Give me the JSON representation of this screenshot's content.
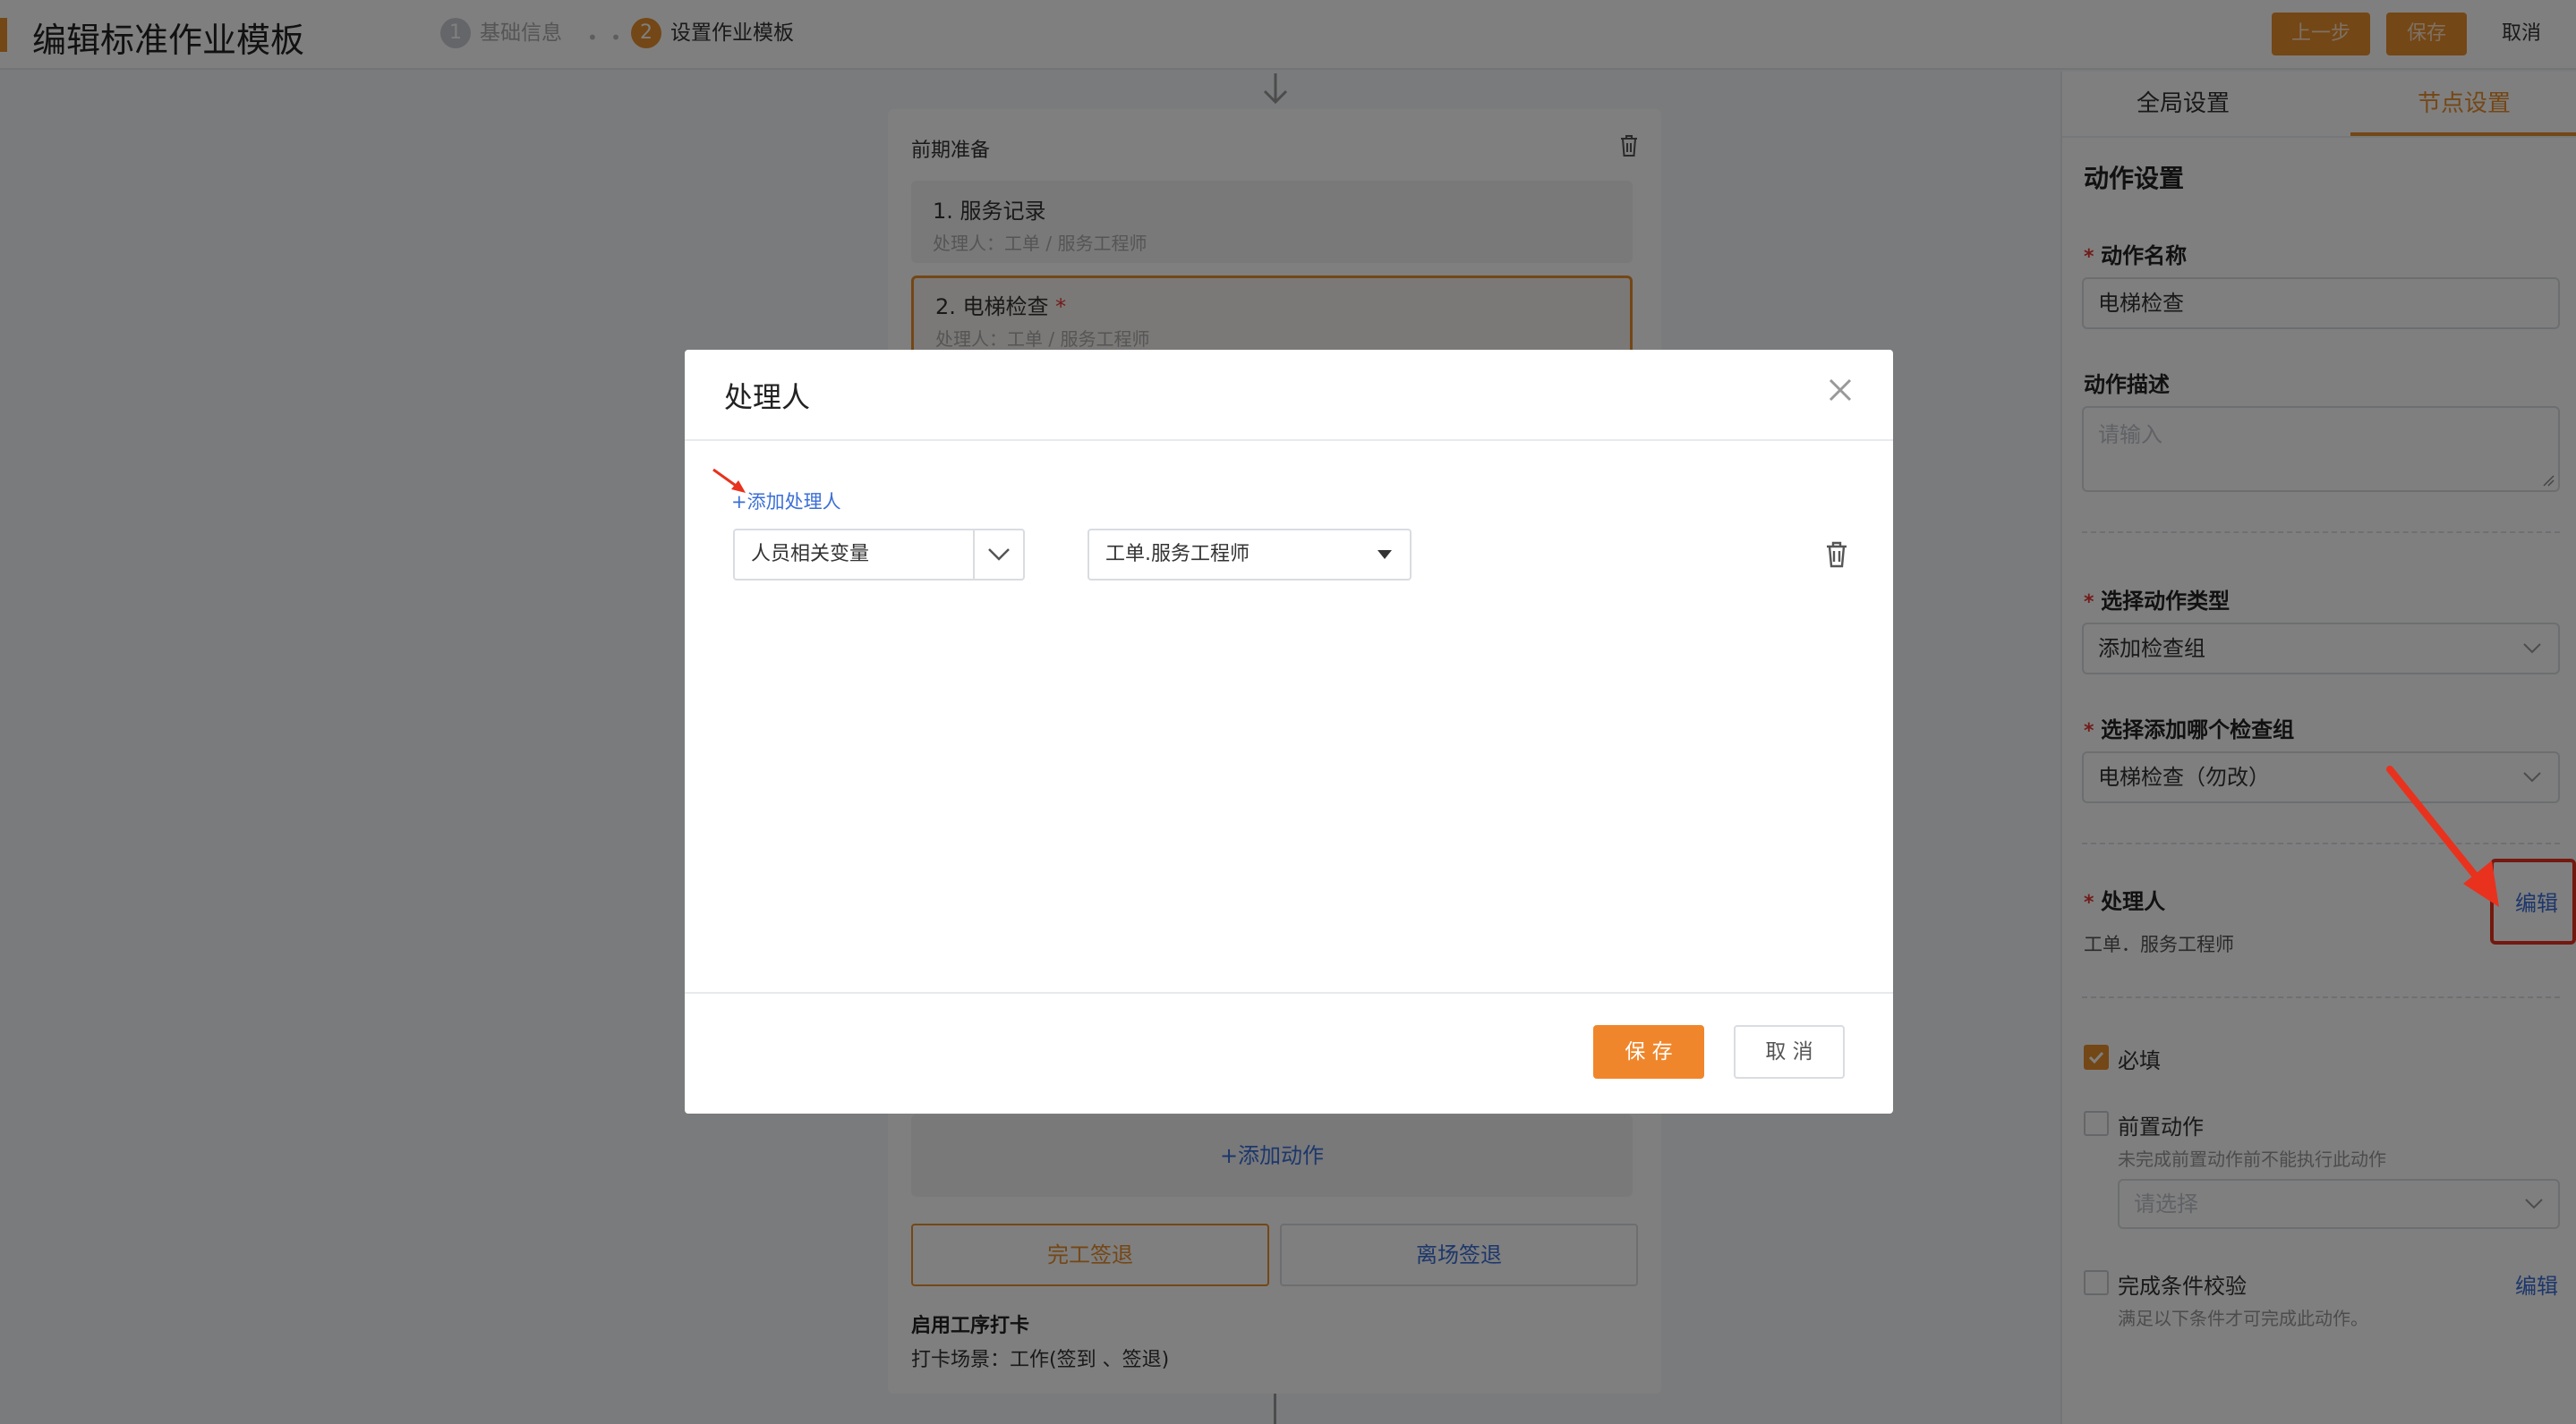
{
  "header": {
    "title": "编辑标准作业模板",
    "steps": [
      {
        "num": "1",
        "label": "基础信息",
        "active": false
      },
      {
        "num": "2",
        "label": "设置作业模板",
        "active": true
      }
    ],
    "buttons": {
      "prev": "上一步",
      "save": "保存",
      "cancel": "取消"
    }
  },
  "canvas": {
    "group_title": "前期准备",
    "actions": [
      {
        "title": "1. 服务记录",
        "handler": "处理人：工单 / 服务工程师",
        "selected": false,
        "required": false
      },
      {
        "title": "2. 电梯检查",
        "handler": "处理人：工单 / 服务工程师",
        "selected": true,
        "required": true
      }
    ],
    "add_action": "+添加动作",
    "finish_checkout": "完工签退",
    "leave_checkout": "离场签退",
    "punch_title": "启用工序打卡",
    "punch_scene": "打卡场景：工作(签到 、签退)"
  },
  "panel": {
    "tabs": [
      "全局设置",
      "节点设置"
    ],
    "active_tab": 1,
    "section_title": "动作设置",
    "action_name_label": "动作名称",
    "action_name_value": "电梯检查",
    "action_desc_label": "动作描述",
    "action_desc_placeholder": "请输入",
    "action_type_label": "选择动作类型",
    "action_type_value": "添加检查组",
    "check_group_label": "选择添加哪个检查组",
    "check_group_value": "电梯检查（勿改）",
    "handler_label": "处理人",
    "handler_edit": "编辑",
    "handler_value": "工单．服务工程师",
    "required_label": "必填",
    "pre_action_label": "前置动作",
    "pre_action_hint": "未完成前置动作前不能执行此动作",
    "pre_action_placeholder": "请选择",
    "complete_check_label": "完成条件校验",
    "complete_check_edit": "编辑",
    "complete_check_hint": "满足以下条件才可完成此动作。"
  },
  "modal": {
    "title": "处理人",
    "add_link": "+添加处理人",
    "type_select": "人员相关变量",
    "value_select": "工单.服务工程师",
    "save": "保 存",
    "cancel": "取 消"
  },
  "colors": {
    "accent": "#e98e2c",
    "link": "#3b6fd6",
    "annotation": "#e8321e"
  }
}
